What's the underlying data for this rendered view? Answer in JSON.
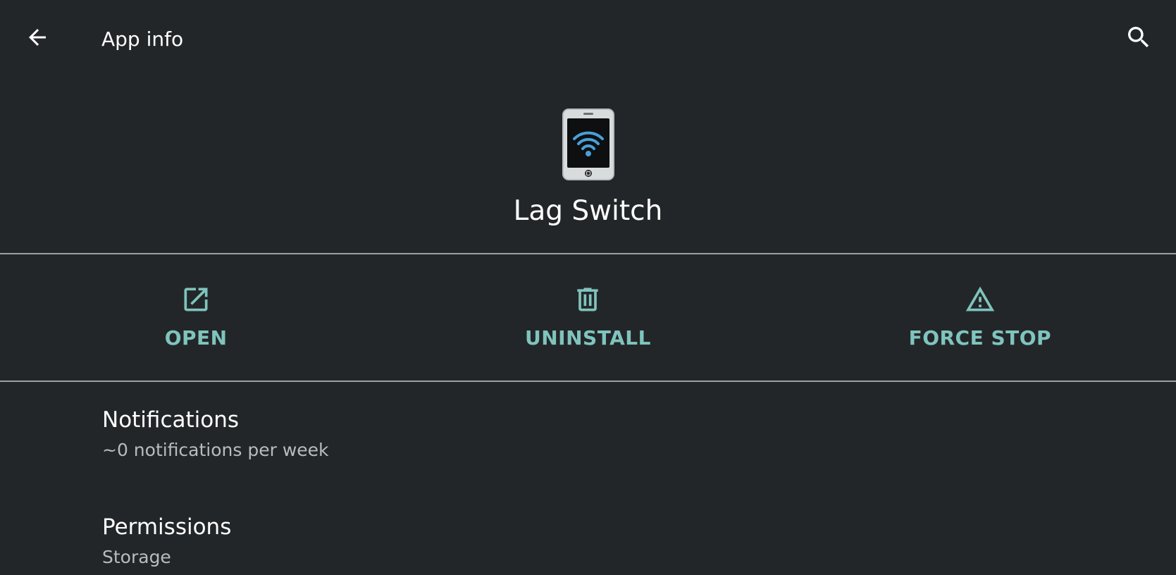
{
  "appbar": {
    "title": "App info",
    "back_icon": "arrow-back-icon",
    "search_icon": "search-icon"
  },
  "app": {
    "name": "Lag Switch",
    "icon": "phone-wifi-app-icon"
  },
  "actions": [
    {
      "label": "OPEN",
      "icon": "open-external-icon"
    },
    {
      "label": "UNINSTALL",
      "icon": "trash-icon"
    },
    {
      "label": "FORCE STOP",
      "icon": "warning-icon"
    }
  ],
  "list": {
    "notifications": {
      "title": "Notifications",
      "subtitle": "~0 notifications per week"
    },
    "permissions": {
      "title": "Permissions",
      "subtitle": "Storage"
    }
  },
  "colors": {
    "background": "#232629",
    "accent": "#7fc4bd",
    "divider": "#9aa0a3",
    "secondary_text": "#b8bcbf"
  }
}
